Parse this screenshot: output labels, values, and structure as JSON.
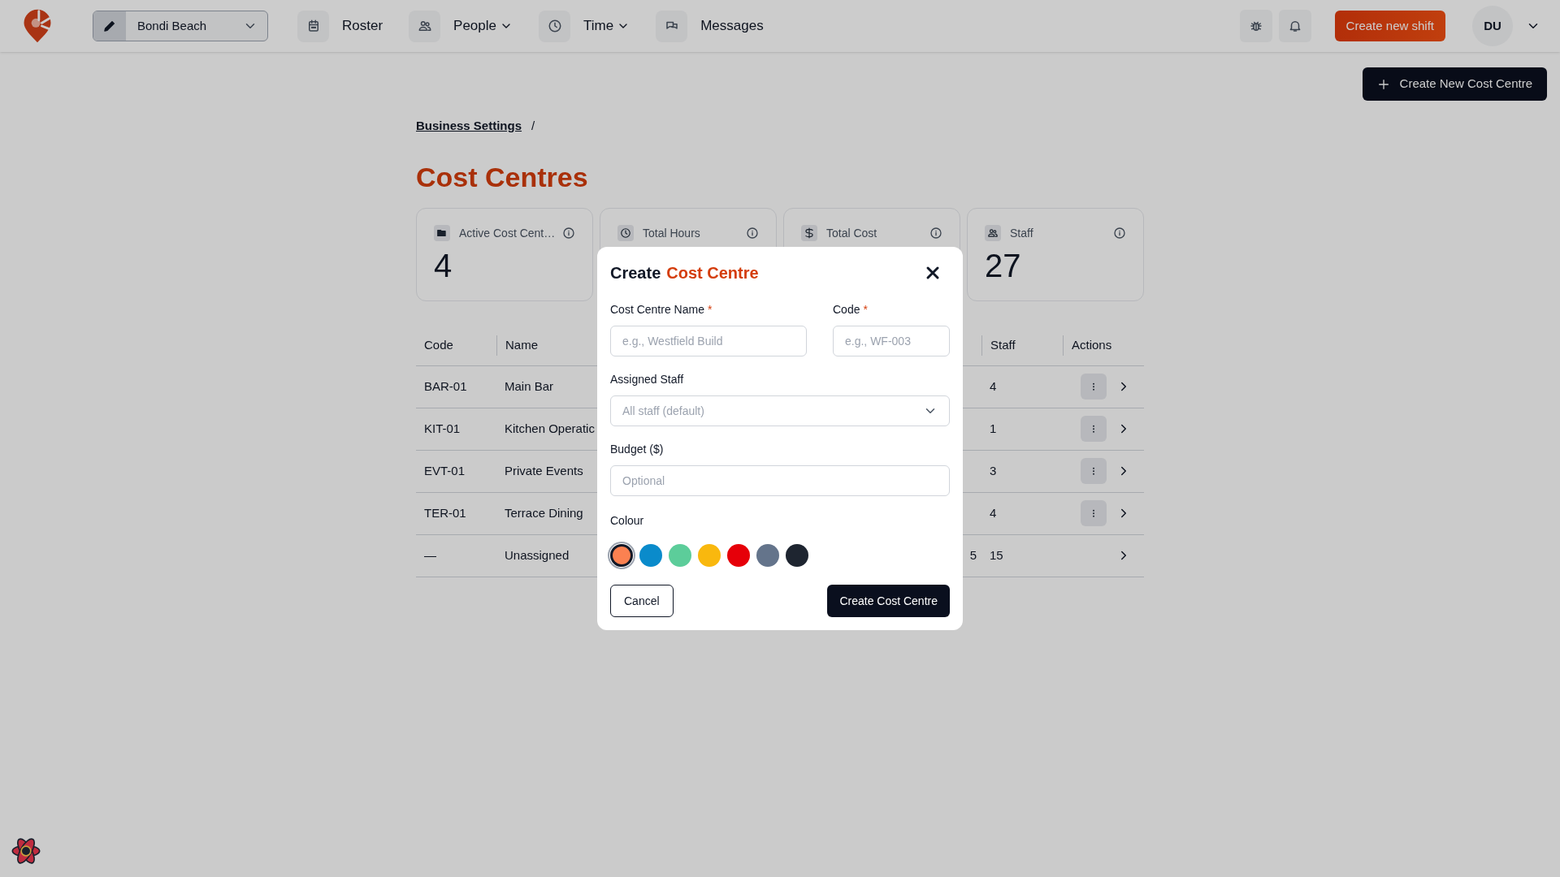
{
  "header": {
    "location": "Bondi Beach",
    "nav": [
      {
        "kind": "calendar",
        "label": "Roster",
        "has_menu": false
      },
      {
        "kind": "people",
        "label": "People",
        "has_menu": true
      },
      {
        "kind": "clock",
        "label": "Time",
        "has_menu": true
      },
      {
        "kind": "chat",
        "label": "Messages",
        "has_menu": false
      }
    ],
    "create_shift": "Create new shift",
    "avatar": "DU"
  },
  "page": {
    "create_button": "Create New Cost Centre",
    "breadcrumb": "Business Settings",
    "breadcrumb_separator": "/",
    "title": "Cost Centres",
    "stats": [
      {
        "kind": "folder",
        "label": "Active Cost Cent…",
        "value": "4"
      },
      {
        "kind": "clock",
        "label": "Total Hours"
      },
      {
        "kind": "dollar",
        "label": "Total Cost"
      },
      {
        "kind": "people",
        "label": "Staff",
        "value": "27"
      }
    ],
    "table": {
      "columns": [
        "Code",
        "Name",
        "Staff",
        "Actions"
      ],
      "rows": [
        {
          "code": "BAR-01",
          "name": "Main Bar",
          "staff": "4",
          "has_menu": true
        },
        {
          "code": "KIT-01",
          "name": "Kitchen Operatic",
          "staff": "1",
          "has_menu": true
        },
        {
          "code": "EVT-01",
          "name": "Private Events",
          "staff": "3",
          "has_menu": true
        },
        {
          "code": "TER-01",
          "name": "Terrace Dining",
          "staff": "4",
          "has_menu": true
        },
        {
          "code": "—",
          "name": "Unassigned",
          "column_3": "5",
          "staff": "15",
          "has_menu": false
        }
      ]
    }
  },
  "modal": {
    "title": "Create",
    "title_accent": "Cost Centre",
    "name_field": {
      "label": "Cost Centre Name",
      "required_mark": "*",
      "placeholder": "e.g., Westfield Build"
    },
    "code_field": {
      "label": "Code",
      "required_mark": "*",
      "placeholder": "e.g., WF-003"
    },
    "staff_select": {
      "label": "Assigned Staff",
      "placeholder": "All staff (default)"
    },
    "budget_field": {
      "label": "Budget ($)",
      "placeholder": "Optional"
    },
    "colour_label": "Colour",
    "colours": [
      {
        "color": "#fb8151",
        "selected": true
      },
      {
        "color": "#0a8bcb",
        "selected": false
      },
      {
        "color": "#5ccd9a",
        "selected": false
      },
      {
        "color": "#f9b80e",
        "selected": false
      },
      {
        "color": "#e60009",
        "selected": false
      },
      {
        "color": "#64748b",
        "selected": false
      },
      {
        "color": "#1e2530",
        "selected": false
      }
    ],
    "cancel": "Cancel",
    "submit": "Create Cost Centre"
  }
}
